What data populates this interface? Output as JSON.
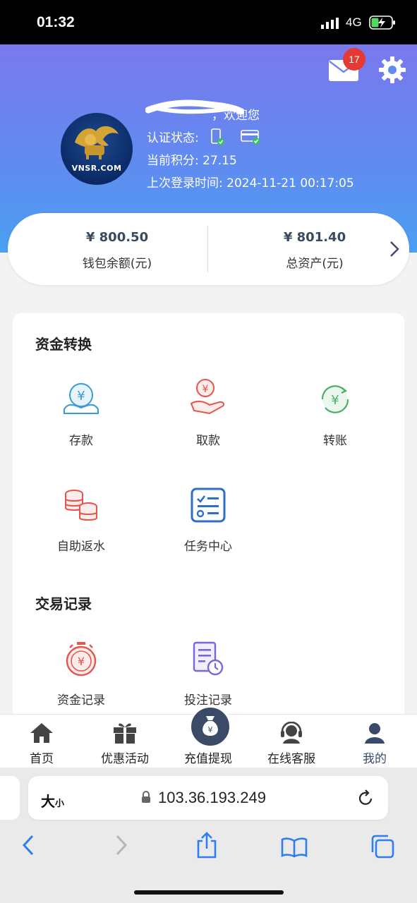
{
  "status_bar": {
    "time": "01:32",
    "network": "4G",
    "icons": [
      "signal-icon",
      "battery-charging-icon"
    ]
  },
  "header": {
    "mail_badge": "17",
    "icons": [
      "mail-icon",
      "gear-icon"
    ],
    "welcome_suffix": "，欢迎您",
    "verify_label": "认证状态:",
    "verify_icons": [
      "phone-verified-icon",
      "card-verified-icon"
    ],
    "points_line": "当前积分: 27.15",
    "last_login_line": "上次登录时间: 2024-11-21 00:17:05",
    "avatar_text": "VNSR.COM"
  },
  "balance": {
    "wallet_amount": "¥ 800.50",
    "wallet_label": "钱包余额(元)",
    "total_amount": "¥ 801.40",
    "total_label": "总资产(元)"
  },
  "funds": {
    "title": "资金转换",
    "items": [
      {
        "label": "存款",
        "icon": "deposit-icon"
      },
      {
        "label": "取款",
        "icon": "withdraw-icon"
      },
      {
        "label": "转账",
        "icon": "transfer-icon"
      },
      {
        "label": "自助返水",
        "icon": "coins-stack-icon"
      },
      {
        "label": "任务中心",
        "icon": "task-list-icon"
      }
    ]
  },
  "records": {
    "title": "交易记录",
    "items": [
      {
        "label": "资金记录",
        "icon": "stopwatch-yuan-icon"
      },
      {
        "label": "投注记录",
        "icon": "document-clock-icon"
      }
    ]
  },
  "tabbar": {
    "tabs": [
      {
        "label": "首页",
        "icon": "home-icon"
      },
      {
        "label": "优惠活动",
        "icon": "gift-icon"
      },
      {
        "label": "充值提现",
        "icon": "money-bag-icon"
      },
      {
        "label": "在线客服",
        "icon": "headset-icon"
      },
      {
        "label": "我的",
        "icon": "user-icon"
      }
    ],
    "active_tab": "我的"
  },
  "browser": {
    "text_size_big": "大",
    "text_size_small": "小",
    "url": "103.36.193.249",
    "icons": [
      "lock-icon",
      "reload-icon",
      "back-icon",
      "forward-icon",
      "share-icon",
      "bookmarks-icon",
      "tabs-icon"
    ]
  },
  "colors": {
    "hero_start": "#7a78ee",
    "hero_end": "#4aa0f2",
    "accent_dark": "#3b4a66",
    "badge": "#e53935"
  }
}
